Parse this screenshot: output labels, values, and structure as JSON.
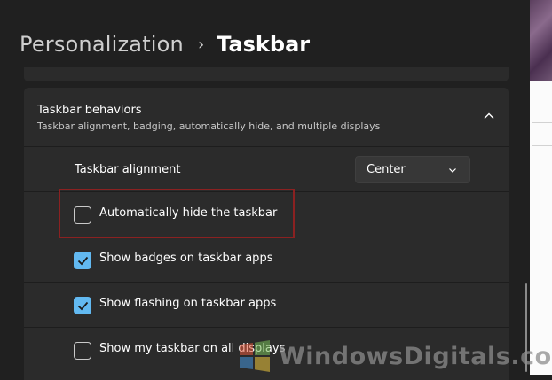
{
  "breadcrumb": {
    "parent": "Personalization",
    "separator": "›",
    "current": "Taskbar"
  },
  "section": {
    "title": "Taskbar behaviors",
    "subtitle": "Taskbar alignment, badging, automatically hide, and multiple displays",
    "expanded": true
  },
  "settings": {
    "alignment": {
      "label": "Taskbar alignment",
      "value": "Center"
    },
    "items": [
      {
        "label": "Automatically hide the taskbar",
        "checked": false
      },
      {
        "label": "Show badges on taskbar apps",
        "checked": true
      },
      {
        "label": "Show flashing on taskbar apps",
        "checked": true
      },
      {
        "label": "Show my taskbar on all displays",
        "checked": false
      }
    ]
  },
  "watermark": {
    "text": "WindowsDigitals.com"
  },
  "colors": {
    "accent": "#62b9f1",
    "highlight": "#8b2121",
    "background": "#202020",
    "card": "#2b2b2b"
  }
}
